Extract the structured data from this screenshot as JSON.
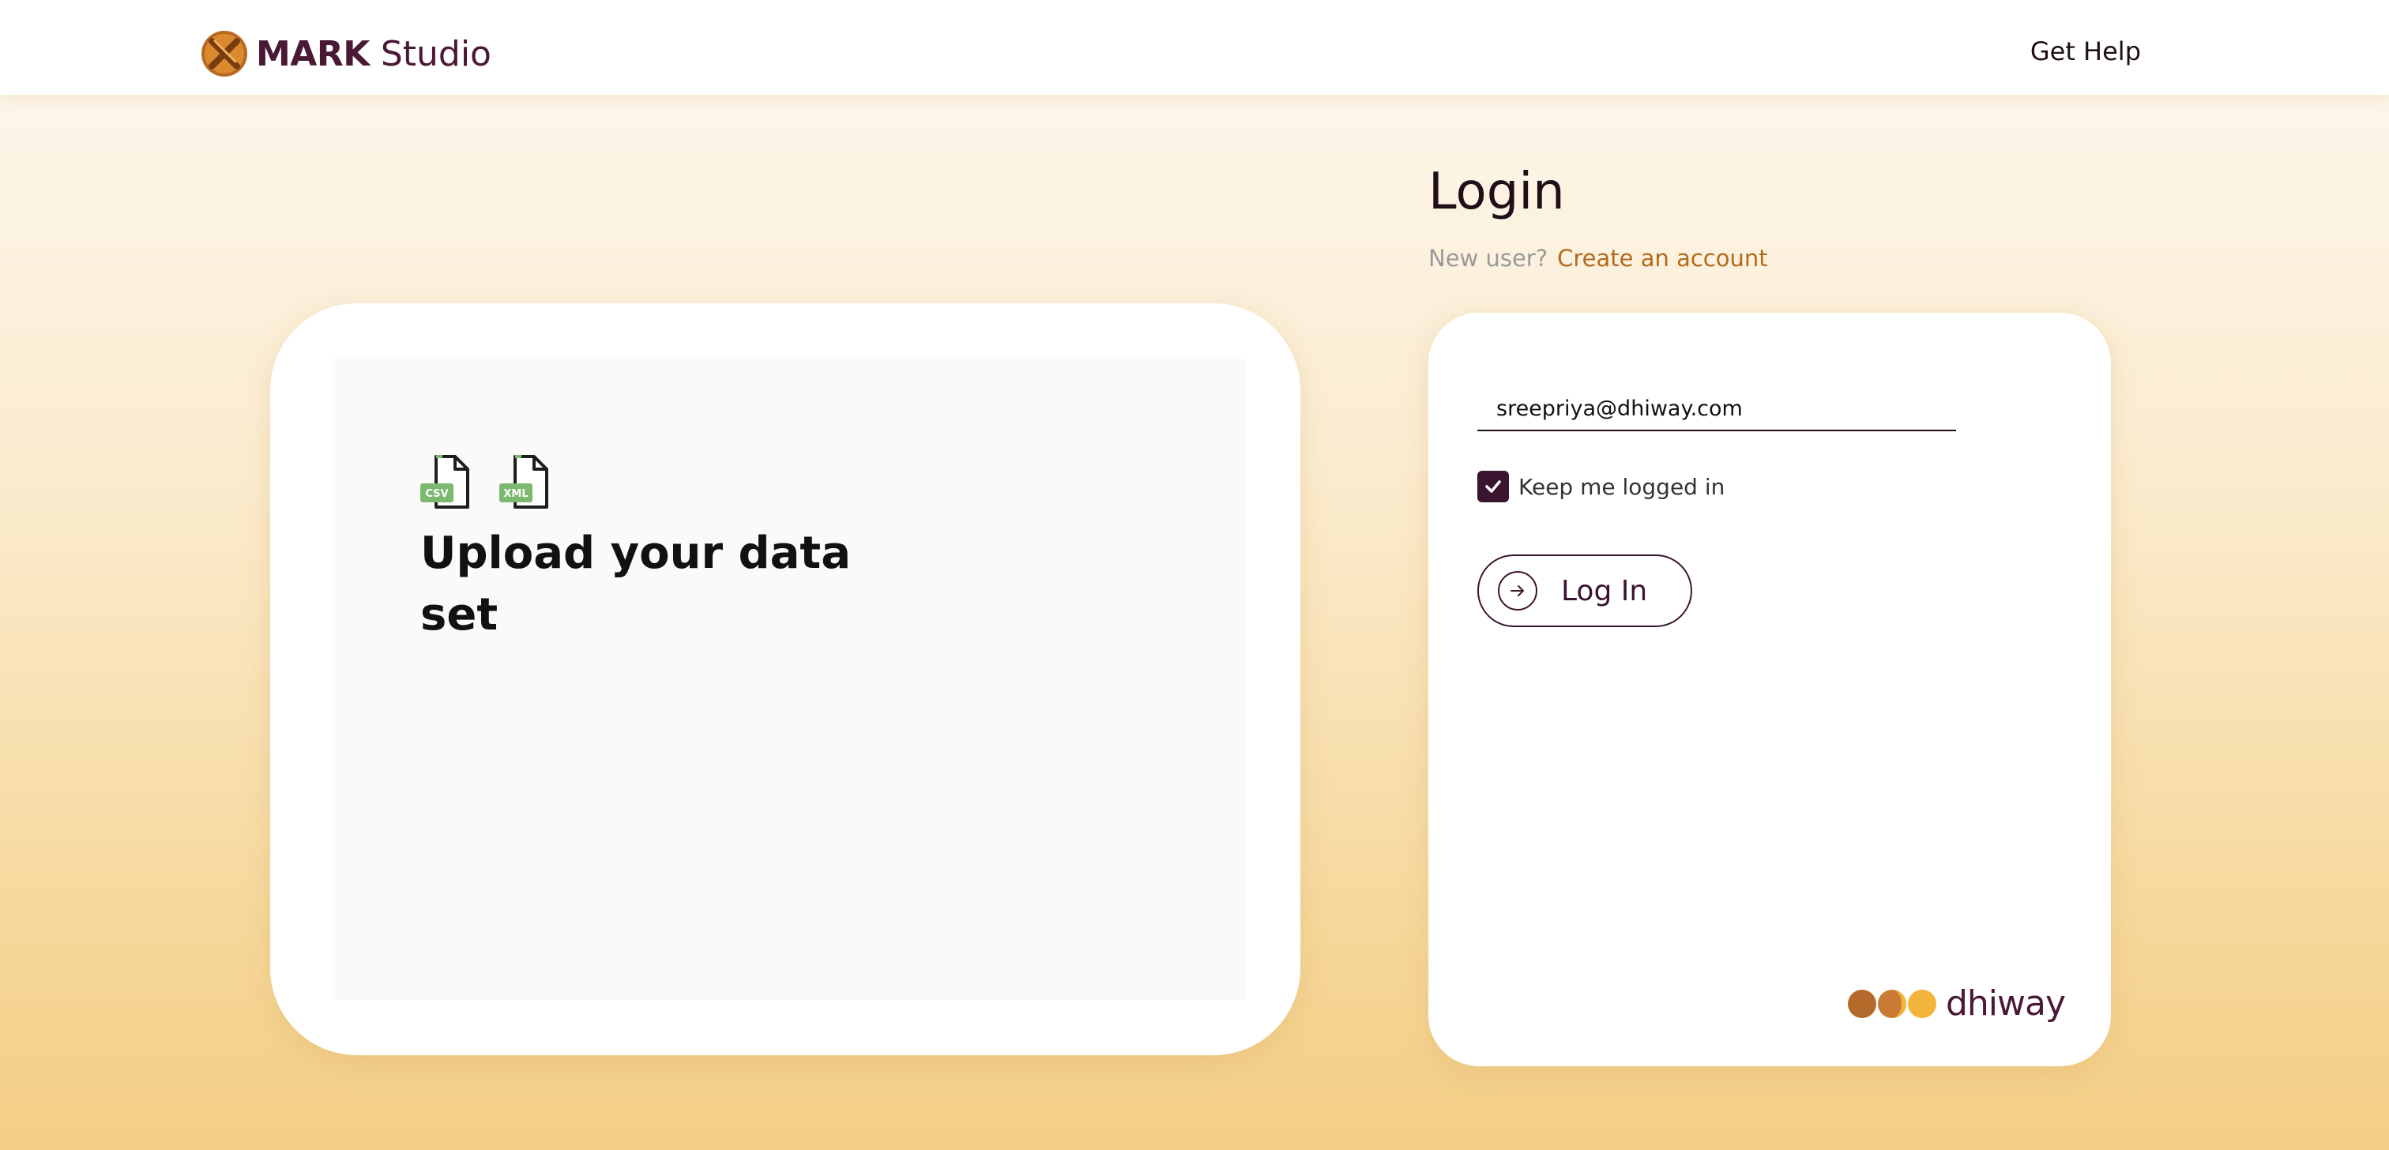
{
  "header": {
    "brand_name": "MARK",
    "brand_sub": "Studio",
    "logo_icon": "mark-logo-icon",
    "help_label": "Get Help"
  },
  "upload": {
    "file_icons": [
      {
        "icon": "csv-file-icon",
        "badge": "CSV"
      },
      {
        "icon": "xml-file-icon",
        "badge": "XML"
      }
    ],
    "title": "Upload your data set"
  },
  "login": {
    "heading": "Login",
    "signup_prompt": "New user?",
    "signup_link": "Create an account",
    "email_value": "sreepriya@dhiway.com",
    "keep_logged_in_label": "Keep me logged in",
    "keep_logged_in_checked": true,
    "login_button_label": "Log In",
    "partner_name": "dhiway"
  },
  "colors": {
    "brand": "#4a1936",
    "accent_link": "#b46a1d",
    "checkbox": "#3b1430",
    "file_badge": "#7db86f"
  }
}
